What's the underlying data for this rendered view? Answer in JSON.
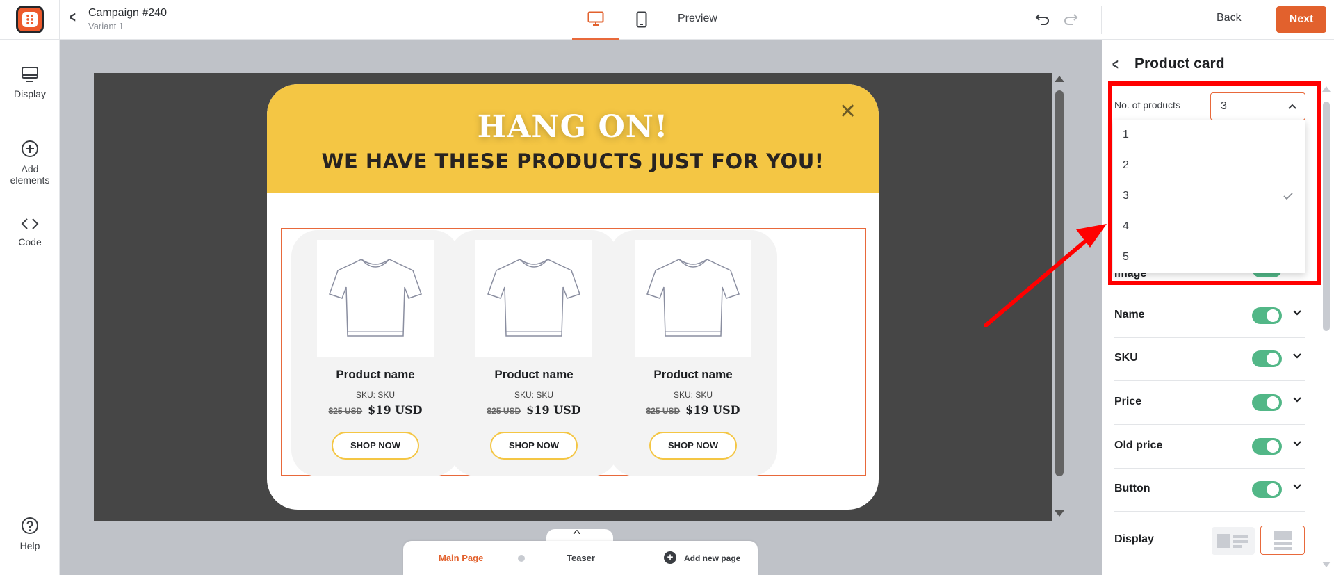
{
  "header": {
    "campaign_title": "Campaign #240",
    "variant": "Variant 1",
    "preview_label": "Preview",
    "back_label": "Back",
    "next_label": "Next"
  },
  "sidebar": {
    "items": [
      {
        "label": "Display",
        "icon": "monitor-icon"
      },
      {
        "label": "Add elements",
        "icon": "plus-circle-icon"
      },
      {
        "label": "Code",
        "icon": "code-icon"
      },
      {
        "label": "Help",
        "icon": "help-icon"
      }
    ]
  },
  "popup": {
    "headline": "HANG ON!",
    "subheadline": "WE HAVE THESE PRODUCTS JUST FOR YOU!",
    "header_color": "#f4c644",
    "products": [
      {
        "name": "Product name",
        "sku": "SKU: SKU",
        "old_price": "$25 USD",
        "price": "$19 USD",
        "button": "SHOP NOW"
      },
      {
        "name": "Product name",
        "sku": "SKU: SKU",
        "old_price": "$25 USD",
        "price": "$19 USD",
        "button": "SHOP NOW"
      },
      {
        "name": "Product name",
        "sku": "SKU: SKU",
        "old_price": "$25 USD",
        "price": "$19 USD",
        "button": "SHOP NOW"
      }
    ]
  },
  "pages": {
    "main": "Main Page",
    "teaser": "Teaser",
    "add": "Add new page"
  },
  "panel": {
    "title": "Product card",
    "no_of_products_label": "No. of products",
    "no_of_products_value": "3",
    "options": [
      "1",
      "2",
      "3",
      "4",
      "5"
    ],
    "selected_option": "3",
    "image_peek_label": "Image",
    "rows": [
      {
        "label": "Name",
        "enabled": true
      },
      {
        "label": "SKU",
        "enabled": true
      },
      {
        "label": "Price",
        "enabled": true
      },
      {
        "label": "Old price",
        "enabled": true
      },
      {
        "label": "Button",
        "enabled": true
      }
    ],
    "display_label": "Display"
  },
  "colors": {
    "accent": "#e2612d",
    "toggle_on": "#52b787",
    "annotation": "#ff0000"
  }
}
